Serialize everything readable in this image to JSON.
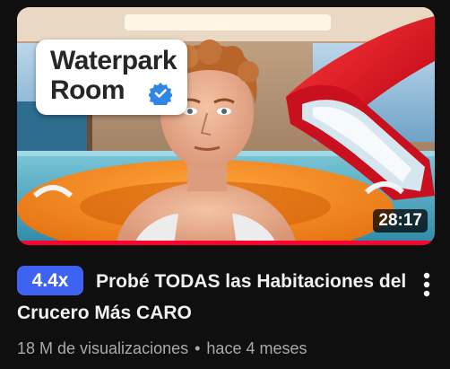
{
  "thumbnail": {
    "overlay_line1": "Waterpark",
    "overlay_line2": "Room",
    "duration": "28:17",
    "watch_progress": 1.0,
    "colors": {
      "progress": "#ff0033",
      "slide": "#d9101e",
      "float_ring": "#f28a1c",
      "water": "#4fb0c8"
    }
  },
  "badge": {
    "label": "4.4x",
    "color": "#3e63f2"
  },
  "video": {
    "title": "Probé TODAS las Habitaciones del Crucero Más CARO",
    "views": "18 M de visualizaciones",
    "separator": "•",
    "age": "hace 4 meses"
  },
  "icons": {
    "verified": "verified-check-icon",
    "more": "more-vertical-icon"
  }
}
